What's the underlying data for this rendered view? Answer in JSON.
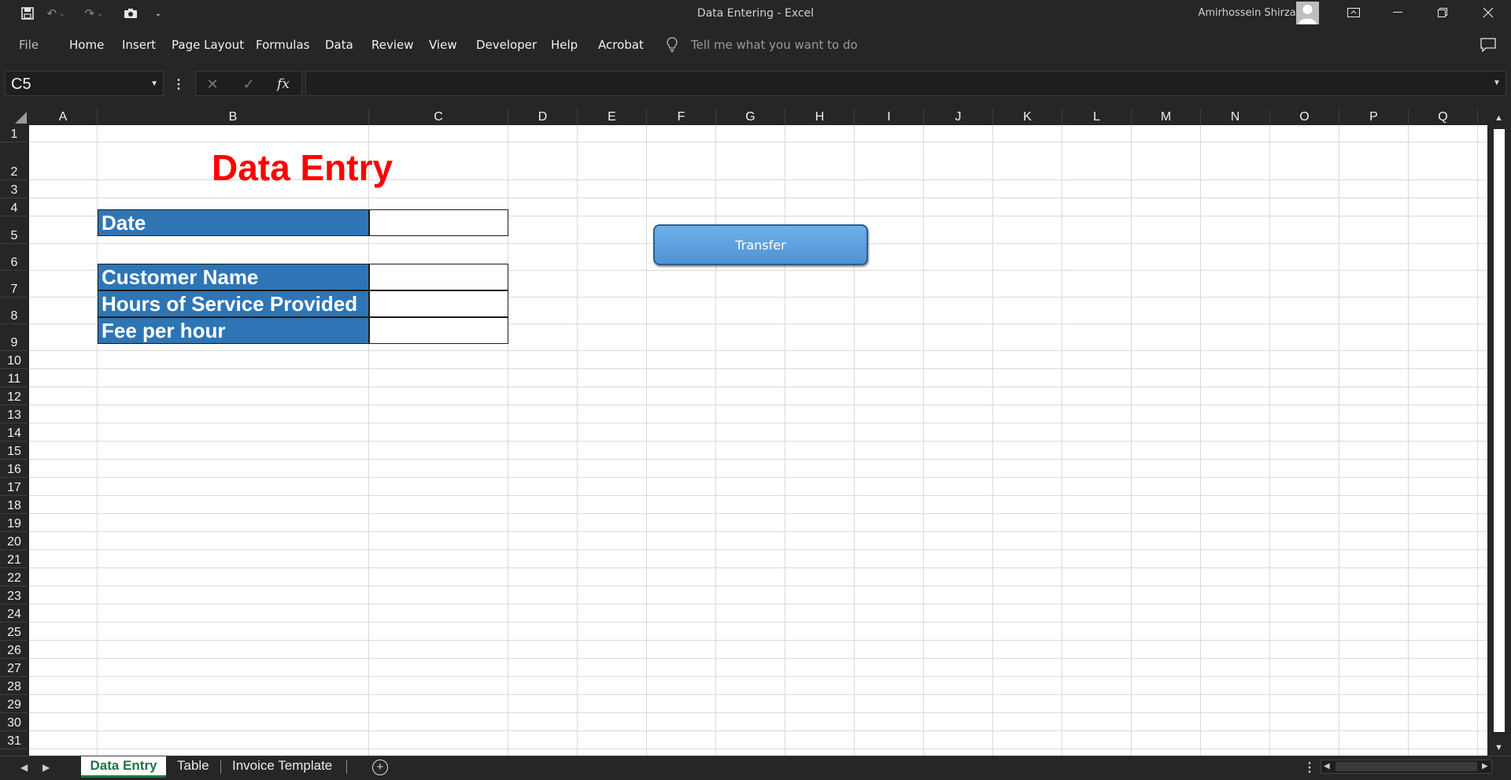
{
  "window": {
    "title": "Data Entering  -  Excel",
    "user_name": "Amirhossein Shirzad"
  },
  "menu": {
    "file": "File",
    "items": [
      "Home",
      "Insert",
      "Page Layout",
      "Formulas",
      "Data",
      "Review",
      "View",
      "Developer",
      "Help",
      "Acrobat"
    ],
    "tell_me": "Tell me what you want to do"
  },
  "formula_bar": {
    "name_box": "C5",
    "fx_label": "fx",
    "formula": ""
  },
  "columns": [
    "A",
    "B",
    "C",
    "D",
    "E",
    "F",
    "G",
    "H",
    "I",
    "J",
    "K",
    "L",
    "M",
    "N",
    "O",
    "P",
    "Q"
  ],
  "rows": [
    "1",
    "2",
    "3",
    "4",
    "5",
    "6",
    "7",
    "8",
    "9",
    "10",
    "11",
    "12",
    "13",
    "14",
    "15",
    "16",
    "17",
    "18",
    "19",
    "20",
    "21",
    "22",
    "23",
    "24",
    "25",
    "26",
    "27",
    "28",
    "29",
    "30",
    "31"
  ],
  "sheet": {
    "heading": "Data Entry",
    "labels": {
      "date": "Date",
      "customer_name": "Customer Name",
      "hours": "Hours of Service Provided",
      "fee": "Fee per hour"
    },
    "values": {
      "date": "",
      "customer_name": "",
      "hours": "",
      "fee": ""
    },
    "button": "Transfer"
  },
  "tabs": {
    "active": "Data Entry",
    "others": [
      "Table",
      "Invoice Template"
    ]
  },
  "colors": {
    "label_fill": "#2e75b6",
    "heading": "#ff0000",
    "button": "#5b9bd5",
    "accent": "#217346"
  }
}
